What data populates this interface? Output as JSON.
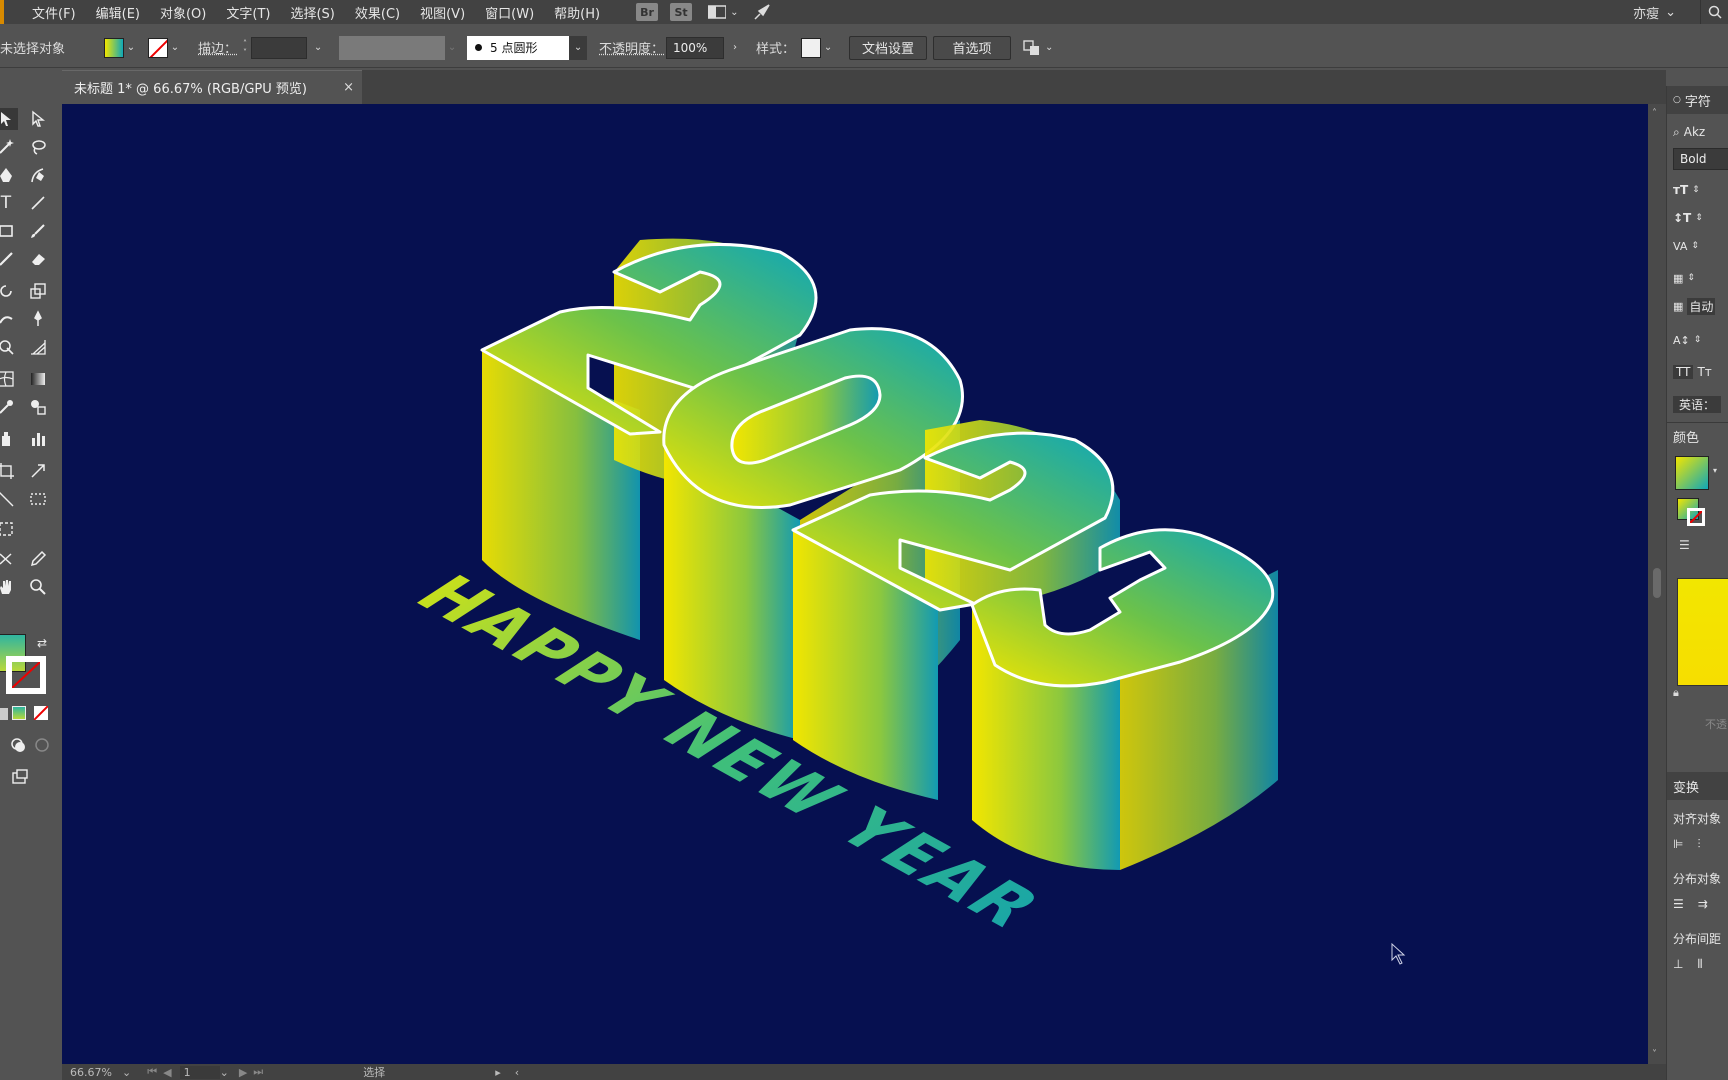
{
  "menu": {
    "items": [
      "文件(F)",
      "编辑(E)",
      "对象(O)",
      "文字(T)",
      "选择(S)",
      "效果(C)",
      "视图(V)",
      "窗口(W)",
      "帮助(H)"
    ],
    "bridge_label": "Br",
    "stock_label": "St",
    "workspace": "亦瘦"
  },
  "control": {
    "selection_status": "未选择对象",
    "stroke_label": "描边：",
    "brush_label": "5 点圆形",
    "opacity_label": "不透明度：",
    "opacity_value": "100%",
    "style_label": "样式：",
    "doc_setup_button": "文档设置",
    "preferences_button": "首选项"
  },
  "document": {
    "tab_title": "未标题 1* @ 66.67% (RGB/GPU 预览)",
    "close_glyph": "×"
  },
  "artwork": {
    "year_digits": [
      "2",
      "0",
      "2",
      "3"
    ],
    "greeting": "HAPPY NEW YEAR",
    "background_color": "#061050",
    "gradient_start": "#f2e600",
    "gradient_mid": "#6cc24a",
    "gradient_end": "#0fa7b8"
  },
  "status": {
    "zoom": "66.67%",
    "artboard": "1",
    "tool_name": "选择"
  },
  "right_panel": {
    "character_tab": "字符",
    "font_search": "Akz",
    "font_style": "Bold",
    "auto_label": "自动",
    "language_label": "英语：",
    "color_tab": "颜色",
    "transform_tab": "变换",
    "align_objects": "对齐对象",
    "distribute_objects": "分布对象",
    "distribute_spacing": "分布间距",
    "opacity_hint": "不透"
  }
}
